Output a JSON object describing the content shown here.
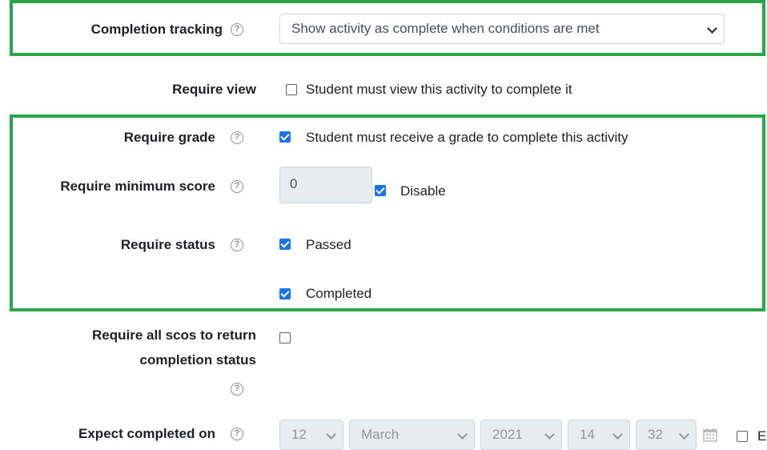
{
  "completion_tracking": {
    "label": "Completion tracking",
    "help": "?",
    "value": "Show activity as complete when conditions are met"
  },
  "require_view": {
    "label": "Require view",
    "checkbox_label": "Student must view this activity to complete it"
  },
  "require_grade": {
    "label": "Require grade",
    "help": "?",
    "checkbox_label": "Student must receive a grade to complete this activity"
  },
  "require_min_score": {
    "label": "Require minimum score",
    "help": "?",
    "value": "0",
    "disable_label": "Disable"
  },
  "require_status": {
    "label": "Require status",
    "help": "?",
    "passed_label": "Passed",
    "completed_label": "Completed"
  },
  "require_all_scos": {
    "label_line1": "Require all scos to return",
    "label_line2": "completion status",
    "help": "?"
  },
  "expect_completed": {
    "label": "Expect completed on",
    "help": "?",
    "day": "12",
    "month": "March",
    "year": "2021",
    "hour": "14",
    "minute": "32",
    "enable_label": "E"
  },
  "colors": {
    "highlight": "#2aa548",
    "checkbox": "#1a73e8"
  }
}
